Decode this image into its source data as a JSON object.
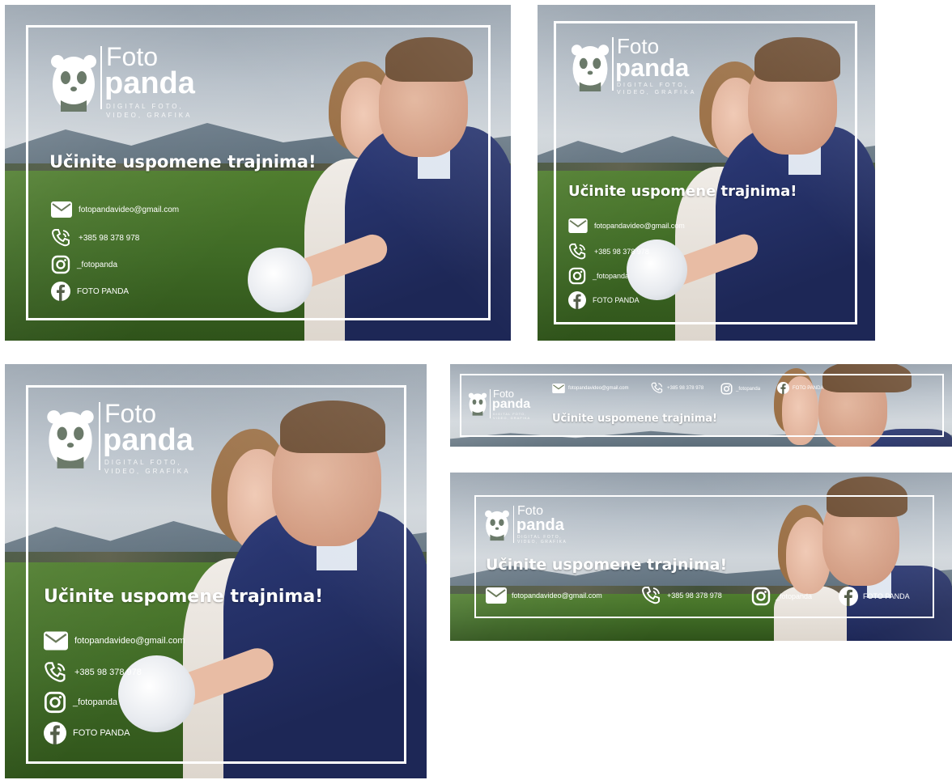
{
  "brand": {
    "foto": "Foto",
    "panda": "panda",
    "tagline_line1": "DIGITAL FOTO,",
    "tagline_line2": "VIDEO, GRAFIKA"
  },
  "headline": "Učinite uspomene trajnima!",
  "contacts": {
    "email": "fotopandavideo@gmail.com",
    "phone": "+385 98 378 978",
    "instagram": "_fotopanda",
    "facebook": "FOTO PANDA"
  },
  "icons": [
    "mail-icon",
    "phone-icon",
    "instagram-icon",
    "facebook-icon",
    "panda-logo-icon"
  ],
  "colors": {
    "text": "#ffffff",
    "suit": "#2c3a78",
    "field": "#4f7d2e",
    "background": "#ffffff"
  }
}
